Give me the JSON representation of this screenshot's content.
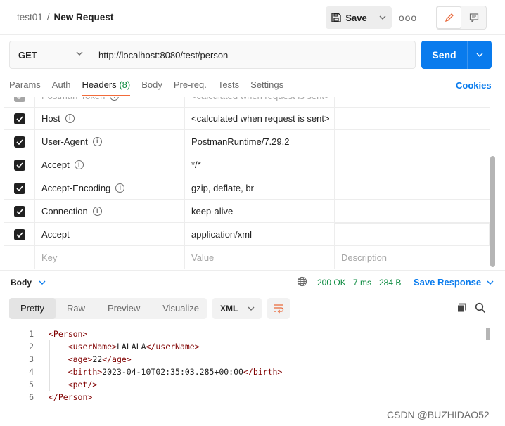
{
  "breadcrumb": {
    "parent": "test01",
    "separator": "/",
    "current": "New Request"
  },
  "toolbar": {
    "save_label": "Save",
    "more_label": "ooo"
  },
  "request": {
    "method": "GET",
    "url": "http://localhost:8080/test/person",
    "send_label": "Send"
  },
  "tabs": [
    {
      "label": "Params"
    },
    {
      "label": "Auth"
    },
    {
      "label": "Headers",
      "count": "(8)"
    },
    {
      "label": "Body"
    },
    {
      "label": "Pre-req."
    },
    {
      "label": "Tests"
    },
    {
      "label": "Settings"
    }
  ],
  "cookies_label": "Cookies",
  "headers": [
    {
      "key": "Postman-Token",
      "value": "<calculated when request is sent>"
    },
    {
      "key": "Host",
      "value": "<calculated when request is sent>"
    },
    {
      "key": "User-Agent",
      "value": "PostmanRuntime/7.29.2"
    },
    {
      "key": "Accept",
      "value": "*/*"
    },
    {
      "key": "Accept-Encoding",
      "value": "gzip, deflate, br"
    },
    {
      "key": "Connection",
      "value": "keep-alive"
    },
    {
      "key": "Accept",
      "value": "application/xml"
    }
  ],
  "new_header": {
    "key_placeholder": "Key",
    "value_placeholder": "Value",
    "desc_placeholder": "Description"
  },
  "response": {
    "section_label": "Body",
    "status": "200 OK",
    "time": "7 ms",
    "size": "284 B",
    "save_label": "Save Response",
    "views": [
      "Pretty",
      "Raw",
      "Preview",
      "Visualize"
    ],
    "format": "XML"
  },
  "code_lines": [
    {
      "n": "1",
      "text": "<Person>"
    },
    {
      "n": "2",
      "text": "    <userName>LALALA</userName>"
    },
    {
      "n": "3",
      "text": "    <age>22</age>"
    },
    {
      "n": "4",
      "text": "    <birth>2023-04-10T02:35:03.285+00:00</birth>"
    },
    {
      "n": "5",
      "text": "    <pet/>"
    },
    {
      "n": "6",
      "text": "</Person>"
    }
  ],
  "watermark": "CSDN @BUZHIDAO52",
  "colors": {
    "accent": "#097bed",
    "active_tab": "#f26b3a",
    "success": "#0b8a3f"
  }
}
